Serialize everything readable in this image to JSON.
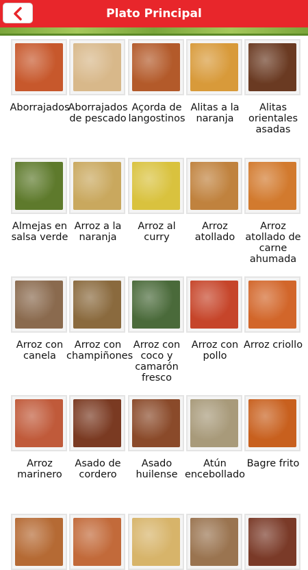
{
  "header": {
    "title": "Plato Principal",
    "back_icon": "chevron-left-icon"
  },
  "colors": {
    "header": "#e8262b",
    "leaf_strip": "#7aa53a"
  },
  "dishes": [
    {
      "label": "Aborrajados",
      "tone": "#c7582c"
    },
    {
      "label": "Aborrajados de pescado",
      "tone": "#d8b88a"
    },
    {
      "label": "Açorda de langostinos",
      "tone": "#b35a2a"
    },
    {
      "label": "Alitas a la naranja",
      "tone": "#d89a3a"
    },
    {
      "label": "Alitas orientales asadas",
      "tone": "#6a3a22"
    },
    {
      "label": "Almejas en salsa verde",
      "tone": "#5e7a2c"
    },
    {
      "label": "Arroz a la naranja",
      "tone": "#c9a85e"
    },
    {
      "label": "Arroz al curry",
      "tone": "#d9c23e"
    },
    {
      "label": "Arroz atollado",
      "tone": "#c0823e"
    },
    {
      "label": "Arroz atollado de carne ahumada",
      "tone": "#d27a2e"
    },
    {
      "label": "Arroz con canela",
      "tone": "#8a6a4e"
    },
    {
      "label": "Arroz con champiñones",
      "tone": "#8a6a3e"
    },
    {
      "label": "Arroz con coco y camarón fresco",
      "tone": "#4a6a3a"
    },
    {
      "label": "Arroz con pollo",
      "tone": "#c6452a"
    },
    {
      "label": "Arroz criollo",
      "tone": "#d2662a"
    },
    {
      "label": "Arroz marinero",
      "tone": "#c05a3a"
    },
    {
      "label": "Asado de cordero",
      "tone": "#7a3a22"
    },
    {
      "label": "Asado huilense",
      "tone": "#8a4a2a"
    },
    {
      "label": "Atún encebollado",
      "tone": "#a89a7a"
    },
    {
      "label": "Bagre frito",
      "tone": "#c8601e"
    },
    {
      "label": "",
      "tone": "#b56a34"
    },
    {
      "label": "",
      "tone": "#c26a3a"
    },
    {
      "label": "",
      "tone": "#d7b46a"
    },
    {
      "label": "",
      "tone": "#9a7450"
    },
    {
      "label": "",
      "tone": "#7a3a28"
    }
  ]
}
